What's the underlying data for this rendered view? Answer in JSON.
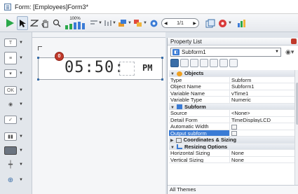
{
  "window": {
    "title": "Form: [Employees]Form3*"
  },
  "toolbar": {
    "zoom": "100%",
    "page": "1/1"
  },
  "clock": {
    "digits": "05:50:",
    "ampm": "PM",
    "badge": "0"
  },
  "palette": {
    "title": "Property List",
    "selected_object": "Subform1",
    "sections": {
      "objects": "Objects",
      "subform": "Subform",
      "coords": "Coordinates & Sizing",
      "resizing": "Resizing Options"
    },
    "rows": {
      "type": {
        "k": "Type",
        "v": "Subform"
      },
      "object_name": {
        "k": "Object Name",
        "v": "Subform1"
      },
      "variable_name": {
        "k": "Variable Name",
        "v": "vTime1"
      },
      "variable_type": {
        "k": "Variable Type",
        "v": "Numeric"
      },
      "source": {
        "k": "Source",
        "v": "<None>"
      },
      "detail_form": {
        "k": "Detail Form",
        "v": "TimeDisplayLCD"
      },
      "automatic_width": {
        "k": "Automatic Width"
      },
      "output_subform": {
        "k": "Output subform"
      },
      "horizontal_sizing": {
        "k": "Horizontal Sizing",
        "v": "None"
      },
      "vertical_sizing": {
        "k": "Vertical Sizing",
        "v": "None"
      }
    },
    "footer": "All Themes"
  },
  "colors": {
    "accent": "#3a7bd5",
    "run_green": "#2aa84a",
    "badge_red": "#c0392b"
  }
}
